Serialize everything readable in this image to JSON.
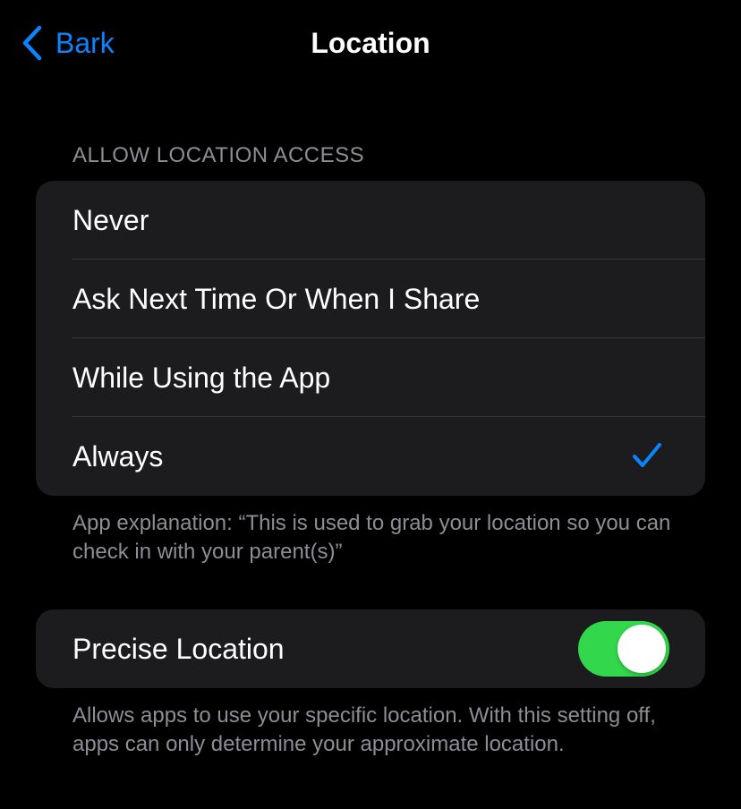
{
  "nav": {
    "back_label": "Bark",
    "back_icon": "chevron-left-icon",
    "title": "Location"
  },
  "access": {
    "header": "ALLOW LOCATION ACCESS",
    "options": [
      {
        "label": "Never",
        "selected": false
      },
      {
        "label": "Ask Next Time Or When I Share",
        "selected": false
      },
      {
        "label": "While Using the App",
        "selected": false
      },
      {
        "label": "Always",
        "selected": true
      }
    ],
    "selected_icon": "checkmark-icon",
    "explanation": "App explanation: “This is used to grab your location so you can check in with your parent(s)”"
  },
  "precise": {
    "label": "Precise Location",
    "enabled": true,
    "description": "Allows apps to use your specific location. With this setting off, apps can only determine your approximate location."
  },
  "colors": {
    "background": "#000000",
    "group_background": "#1c1c1e",
    "accent": "#0a84ff",
    "toggle_on": "#32d74b",
    "secondary_text": "#8d8d93"
  }
}
